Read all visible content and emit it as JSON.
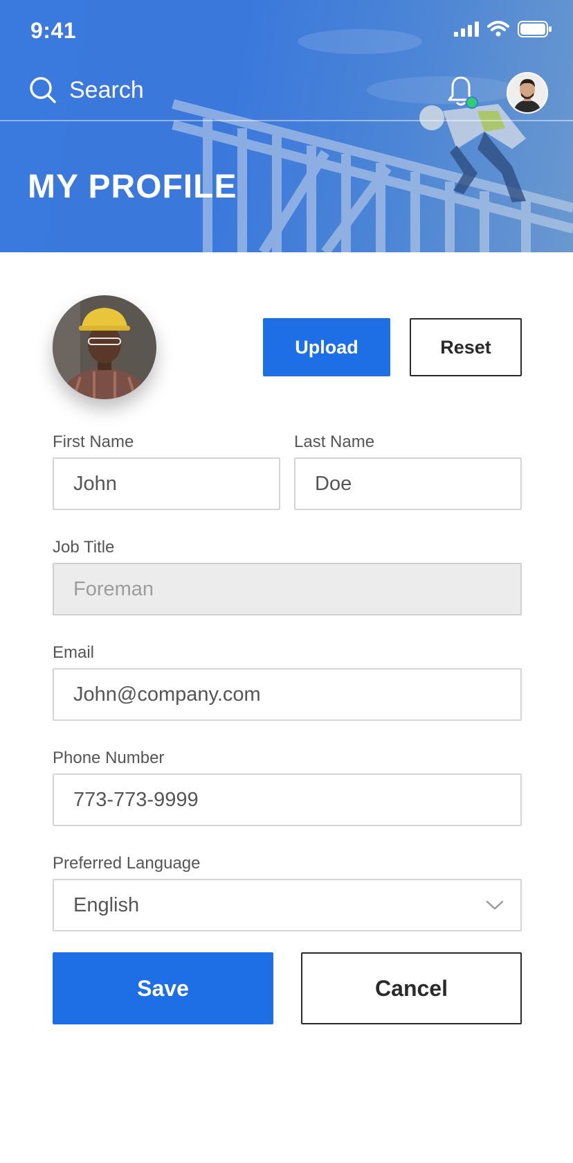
{
  "status_bar": {
    "time": "9:41"
  },
  "header": {
    "search_label": "Search",
    "title": "MY PROFILE",
    "notification_dot_color": "#2fd06b",
    "background_color": "#3a79dd"
  },
  "profile": {
    "upload_label": "Upload",
    "reset_label": "Reset"
  },
  "form": {
    "first_name": {
      "label": "First Name",
      "value": "John"
    },
    "last_name": {
      "label": "Last Name",
      "value": "Doe"
    },
    "job_title": {
      "label": "Job Title",
      "value": "Foreman",
      "disabled": true
    },
    "email": {
      "label": "Email",
      "value": "John@company.com"
    },
    "phone": {
      "label": "Phone Number",
      "value": "773-773-9999"
    },
    "language": {
      "label": "Preferred Language",
      "value": "English"
    }
  },
  "actions": {
    "save_label": "Save",
    "cancel_label": "Cancel"
  },
  "colors": {
    "primary": "#1e6ee6",
    "outline": "#2a2a2a"
  }
}
